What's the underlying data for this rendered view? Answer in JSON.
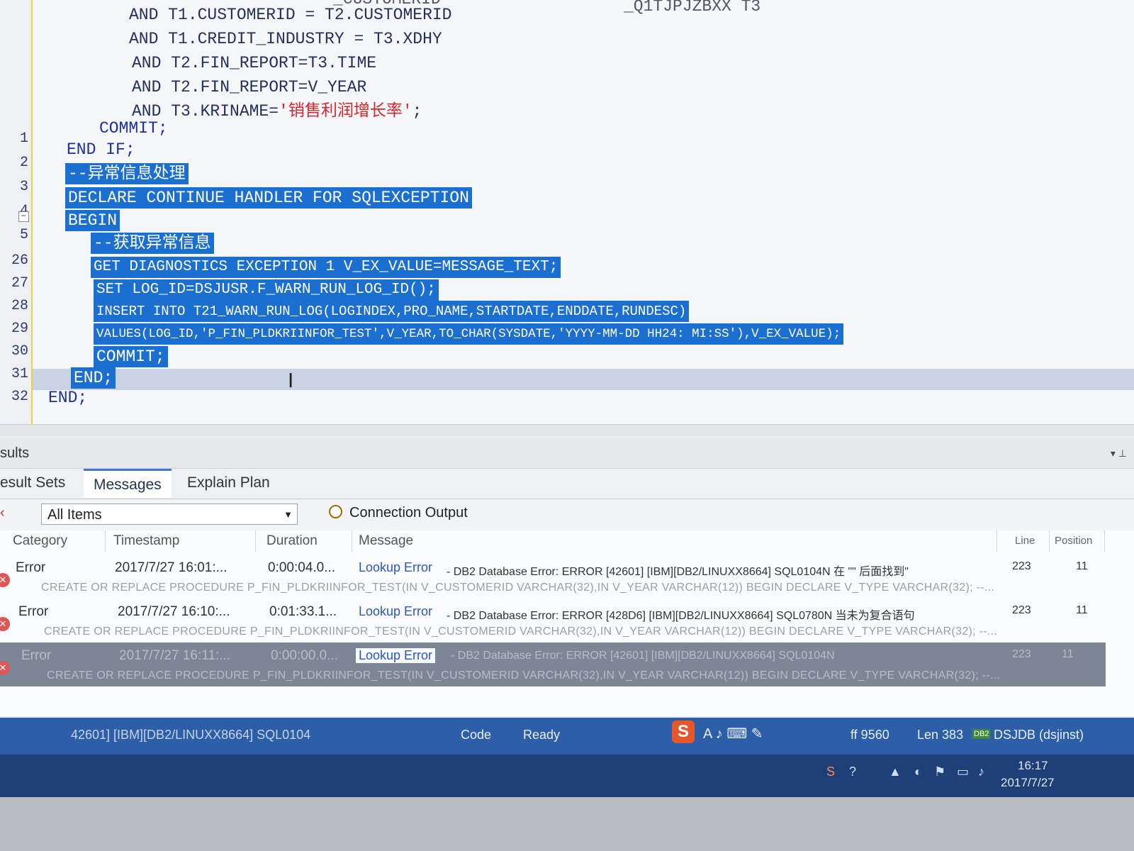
{
  "editor": {
    "line_numbers": [
      "1",
      "2",
      "3",
      "4",
      "5",
      "26",
      "27",
      "28",
      "29",
      "30",
      "31",
      "32"
    ],
    "lines": [
      {
        "id": "l1",
        "text": "AND T1.CUSTOMERID = T2.CUSTOMERID"
      },
      {
        "id": "l2",
        "text": "AND T1.CREDIT_INDUSTRY = T3.XDHY"
      },
      {
        "id": "l3",
        "text": "AND T2.FIN_REPORT=T3.TIME"
      },
      {
        "id": "l4",
        "text": "AND T2.FIN_REPORT=V_YEAR"
      },
      {
        "id": "l5a",
        "text": "AND T3.KRINAME="
      },
      {
        "id": "l5b",
        "text": "'销售利润增长率'"
      },
      {
        "id": "l5c",
        "text": ";"
      },
      {
        "id": "l6",
        "text": "COMMIT;"
      },
      {
        "id": "l7",
        "text": "END IF;"
      },
      {
        "id": "l8",
        "text": "--异常信息处理"
      },
      {
        "id": "l9",
        "text": "DECLARE CONTINUE HANDLER FOR SQLEXCEPTION"
      },
      {
        "id": "l10",
        "text": "BEGIN"
      },
      {
        "id": "l11",
        "text": "--获取异常信息"
      },
      {
        "id": "l12",
        "text": "GET DIAGNOSTICS EXCEPTION 1 V_EX_VALUE=MESSAGE_TEXT;"
      },
      {
        "id": "l13",
        "text": "SET LOG_ID=DSJUSR.F_WARN_RUN_LOG_ID();"
      },
      {
        "id": "l14",
        "text": "INSERT INTO T21_WARN_RUN_LOG(LOGINDEX,PRO_NAME,STARTDATE,ENDDATE,RUNDESC)"
      },
      {
        "id": "l15",
        "text": "VALUES(LOG_ID,'P_FIN_PLDKRIINFOR_TEST',V_YEAR,TO_CHAR(SYSDATE,'YYYY-MM-DD HH24: MI:SS'),V_EX_VALUE);"
      },
      {
        "id": "l16",
        "text": "COMMIT;"
      },
      {
        "id": "l17",
        "text": "END;"
      },
      {
        "id": "l18",
        "text": "END;"
      }
    ],
    "partial_top_left": "_CUSTOMERID",
    "partial_top_right": "_Q1TJPJZBXX T3"
  },
  "results": {
    "title": "sults",
    "tabs": [
      "esult Sets",
      "Messages",
      "Explain Plan"
    ],
    "active_tab": "Messages",
    "filter_value": "All Items",
    "connection_output": "Connection Output",
    "columns": [
      "Category",
      "Timestamp",
      "Duration",
      "Message",
      "Line",
      "Position"
    ],
    "rows": [
      {
        "category": "Error",
        "timestamp": "2017/7/27 16:01:...",
        "duration": "0:00:04.0...",
        "lookup": "Lookup Error",
        "message": "- DB2 Database Error: ERROR [42601] [IBM][DB2/LINUXX8664] SQL0104N 在 \"\" 后面找到\"",
        "line": "223",
        "position": "11",
        "sql": "CREATE OR REPLACE PROCEDURE P_FIN_PLDKRIINFOR_TEST(IN V_CUSTOMERID VARCHAR(32),IN V_YEAR VARCHAR(12)) BEGIN DECLARE V_TYPE VARCHAR(32); --..."
      },
      {
        "category": "Error",
        "timestamp": "2017/7/27 16:10:...",
        "duration": "0:01:33.1...",
        "lookup": "Lookup Error",
        "message": "- DB2 Database Error: ERROR [428D6] [IBM][DB2/LINUXX8664] SQL0780N 当未为复合语句",
        "line": "223",
        "position": "11",
        "sql": "CREATE OR REPLACE PROCEDURE P_FIN_PLDKRIINFOR_TEST(IN V_CUSTOMERID VARCHAR(32),IN V_YEAR VARCHAR(12)) BEGIN DECLARE V_TYPE VARCHAR(32); --..."
      },
      {
        "category": "Error",
        "timestamp": "2017/7/27 16:11:...",
        "duration": "0:00:00.0...",
        "lookup": "Lookup Error",
        "message": "- DB2 Database Error: ERROR [42601] [IBM][DB2/LINUXX8664] SQL0104N",
        "line": "223",
        "position": "11",
        "sql": "CREATE OR REPLACE PROCEDURE P_FIN_PLDKRIINFOR_TEST(IN V_CUSTOMERID VARCHAR(32),IN V_YEAR VARCHAR(12)) BEGIN DECLARE V_TYPE VARCHAR(32); --..."
      }
    ]
  },
  "statusbar": {
    "error_text": "42601] [IBM][DB2/LINUXX8664] SQL0104",
    "mode": "Code",
    "state": "Ready",
    "offset": "ff 9560",
    "length": "Len 383",
    "connection": "DSJDB (dsjinst)"
  },
  "taskbar": {
    "time": "16:17",
    "date": "2017/7/27"
  },
  "icons": {
    "ime": "sogou-ime-icon",
    "db": "db2-connection-icon",
    "error": "error-icon"
  },
  "colors": {
    "selection": "#1a6fd1",
    "keyword": "#1b2fa8",
    "string": "#d9262c",
    "statusbar": "#2d5fa8",
    "link": "#2a56c6"
  }
}
